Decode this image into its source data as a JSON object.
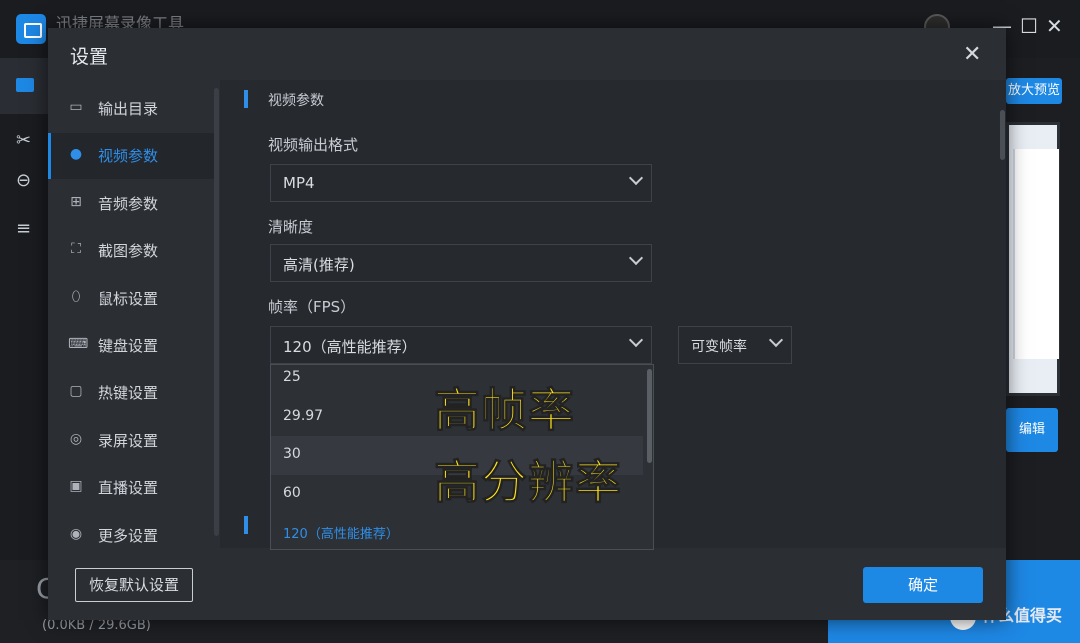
{
  "app": {
    "title": "迅捷屏幕录像工具",
    "window_controls": [
      "—",
      "☐",
      "✕"
    ],
    "preview_button": "放大预览",
    "right_button": "编辑",
    "storage": "(0.0KB / 29.6GB)",
    "big_letter": "C",
    "watermark": "值 什么值得买"
  },
  "dialog": {
    "title": "设置",
    "close": "✕",
    "sidebar": [
      {
        "label": "输出目录",
        "icon": "folder-icon",
        "glyph": "▭"
      },
      {
        "label": "视频参数",
        "icon": "video-icon",
        "glyph": "●"
      },
      {
        "label": "音频参数",
        "icon": "audio-icon",
        "glyph": "⊞"
      },
      {
        "label": "截图参数",
        "icon": "screenshot-icon",
        "glyph": "⛶"
      },
      {
        "label": "鼠标设置",
        "icon": "mouse-icon",
        "glyph": "⬯"
      },
      {
        "label": "键盘设置",
        "icon": "keyboard-icon",
        "glyph": "⌨"
      },
      {
        "label": "热键设置",
        "icon": "hotkey-icon",
        "glyph": "▢"
      },
      {
        "label": "录屏设置",
        "icon": "record-icon",
        "glyph": "◎"
      },
      {
        "label": "直播设置",
        "icon": "live-icon",
        "glyph": "▣"
      },
      {
        "label": "更多设置",
        "icon": "more-settings-icon",
        "glyph": "◉"
      }
    ],
    "active_index": 1,
    "section_title": "视频参数",
    "format_label": "视频输出格式",
    "format_value": "MP4",
    "quality_label": "清晰度",
    "quality_value": "高清(推荐)",
    "fps_label": "帧率（FPS）",
    "fps_value": "120（高性能推荐）",
    "fps_mode_value": "可变帧率",
    "fps_options": [
      "25",
      "29.97",
      "30",
      "60",
      "120（高性能推荐）"
    ],
    "reset_button": "恢复默认设置",
    "ok_button": "确定"
  },
  "overlay": {
    "line1": "高帧率",
    "line2": "高分辨率"
  },
  "colors": {
    "accent": "#1e88e5",
    "overlay_text": "#ffe21a",
    "dialog_bg": "#2b2e33"
  }
}
